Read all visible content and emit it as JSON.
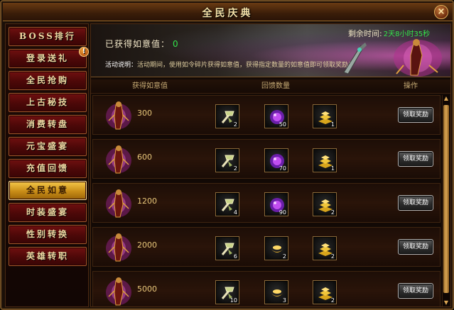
{
  "window": {
    "title": "全民庆典",
    "close_label": "×"
  },
  "sidebar": {
    "items": [
      {
        "label": "BOSS排行",
        "active": false,
        "badge": ""
      },
      {
        "label": "登录送礼",
        "active": false,
        "badge": "!"
      },
      {
        "label": "全民抢购",
        "active": false,
        "badge": ""
      },
      {
        "label": "上古秘技",
        "active": false,
        "badge": ""
      },
      {
        "label": "消费转盘",
        "active": false,
        "badge": ""
      },
      {
        "label": "元宝盛宴",
        "active": false,
        "badge": ""
      },
      {
        "label": "充值回馈",
        "active": false,
        "badge": ""
      },
      {
        "label": "全民如意",
        "active": true,
        "badge": ""
      },
      {
        "label": "时装盛宴",
        "active": false,
        "badge": ""
      },
      {
        "label": "性别转换",
        "active": false,
        "badge": ""
      },
      {
        "label": "英雄转职",
        "active": false,
        "badge": ""
      }
    ]
  },
  "banner": {
    "obtained_label": "已获得如意值：",
    "obtained_value": "0",
    "remaining_label": "剩余时间:",
    "remaining_value": "2天8小时35秒",
    "desc_label": "活动说明：",
    "desc_text": "活动期间，使用如令碎片获得如意值，获得指定数量的如意值即可领取奖励！"
  },
  "table": {
    "headers": [
      "获得如意值",
      "回馈数量",
      "操作"
    ],
    "claim_label": "领取奖励",
    "rows": [
      {
        "value": "300",
        "items": [
          {
            "icon": "crystal-pickaxe-icon",
            "count": "2"
          },
          {
            "icon": "purple-orb-icon",
            "count": "50"
          },
          {
            "icon": "gold-bars-icon",
            "count": "1"
          }
        ]
      },
      {
        "value": "600",
        "items": [
          {
            "icon": "crystal-pickaxe-icon",
            "count": "2"
          },
          {
            "icon": "purple-orb-icon",
            "count": "70"
          },
          {
            "icon": "gold-bars-icon",
            "count": "1"
          }
        ]
      },
      {
        "value": "1200",
        "items": [
          {
            "icon": "crystal-pickaxe-icon",
            "count": "4"
          },
          {
            "icon": "purple-orb-icon",
            "count": "90"
          },
          {
            "icon": "gold-bars-icon",
            "count": "2"
          }
        ]
      },
      {
        "value": "2000",
        "items": [
          {
            "icon": "crystal-pickaxe-icon",
            "count": "6"
          },
          {
            "icon": "gold-ingot-icon",
            "count": "2"
          },
          {
            "icon": "gold-bars-icon",
            "count": "2"
          }
        ]
      },
      {
        "value": "5000",
        "items": [
          {
            "icon": "crystal-pickaxe-icon",
            "count": "10"
          },
          {
            "icon": "gold-ingot-icon",
            "count": "3"
          },
          {
            "icon": "gold-bars-icon",
            "count": "2"
          }
        ]
      }
    ]
  },
  "colors": {
    "accent_gold": "#f5c94a",
    "value_green": "#33e34a",
    "tab_red": "#701010"
  }
}
